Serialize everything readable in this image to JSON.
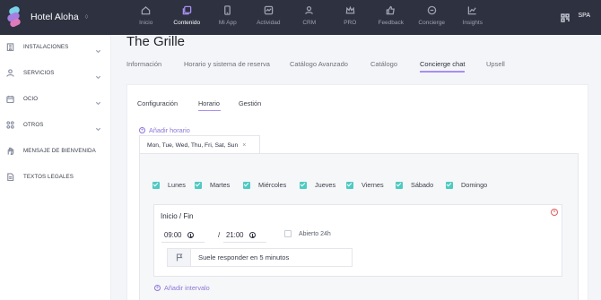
{
  "app": {
    "name": "Hotel Aloha",
    "caret": "◊",
    "user": "SPA"
  },
  "nav": [
    {
      "label": "Inicio",
      "icon": "home-icon"
    },
    {
      "label": "Contenido",
      "icon": "content-icon",
      "active": true
    },
    {
      "label": "Mi App",
      "icon": "phone-icon"
    },
    {
      "label": "Actividad",
      "icon": "activity-icon"
    },
    {
      "label": "CRM",
      "icon": "users-icon"
    },
    {
      "label": "PRO",
      "icon": "crown-icon"
    },
    {
      "label": "Feedback",
      "icon": "thumbs-up-icon"
    },
    {
      "label": "Concierge",
      "icon": "chat-icon"
    },
    {
      "label": "Insights",
      "icon": "chart-icon"
    }
  ],
  "sidebar": [
    {
      "label": "INSTALACIONES",
      "icon": "building-icon",
      "expandable": true
    },
    {
      "label": "SERVICIOS",
      "icon": "service-icon",
      "expandable": true
    },
    {
      "label": "OCIO",
      "icon": "calendar-icon",
      "expandable": true
    },
    {
      "label": "OTROS",
      "icon": "grid-icon",
      "expandable": true
    },
    {
      "label": "MENSAJE DE BIENVENIDA",
      "icon": "hand-icon",
      "expandable": false
    },
    {
      "label": "TEXTOS LEGALES",
      "icon": "document-icon",
      "expandable": false
    }
  ],
  "page": {
    "title": "The Grille",
    "tabs": [
      "Información",
      "Horario y sistema de reserva",
      "Catálogo Avanzado",
      "Catálogo",
      "Concierge chat",
      "Upsell"
    ],
    "active_tab": "Concierge chat"
  },
  "subtabs": [
    "Configuración",
    "Horario",
    "Gestión"
  ],
  "active_subtab": "Horario",
  "add_schedule": "Añadir horario",
  "days_chip": {
    "label": "Mon, Tue, Wed, Thu, Fri, Sat, Sun",
    "close": "×"
  },
  "days": [
    "Lunes",
    "Martes",
    "Miércoles",
    "Jueves",
    "Viernes",
    "Sábado",
    "Domingo"
  ],
  "slot": {
    "title": "Inicio / Fin",
    "start": "09:00",
    "separator": "/",
    "end": "21:00",
    "open24_label": "Abierto 24h",
    "response_text": "Suele responder en 5 minutos",
    "remove": "×"
  },
  "add_interval": "Añadir intervalo",
  "colors": {
    "accent": "#a98ef2",
    "check": "#4fcac2",
    "topbar": "#2d3140",
    "remove": "#e06060"
  }
}
